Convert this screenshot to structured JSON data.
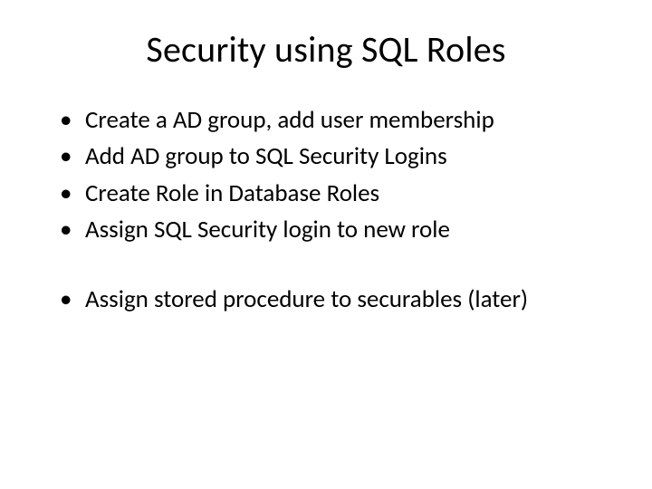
{
  "slide": {
    "title": "Security using SQL Roles",
    "bullets_group1": [
      "Create a AD group, add user membership",
      "Add AD group to SQL Security Logins",
      "Create Role in Database Roles",
      "Assign SQL Security login to new role"
    ],
    "bullets_group2": [
      "Assign stored procedure to securables (later)"
    ]
  }
}
